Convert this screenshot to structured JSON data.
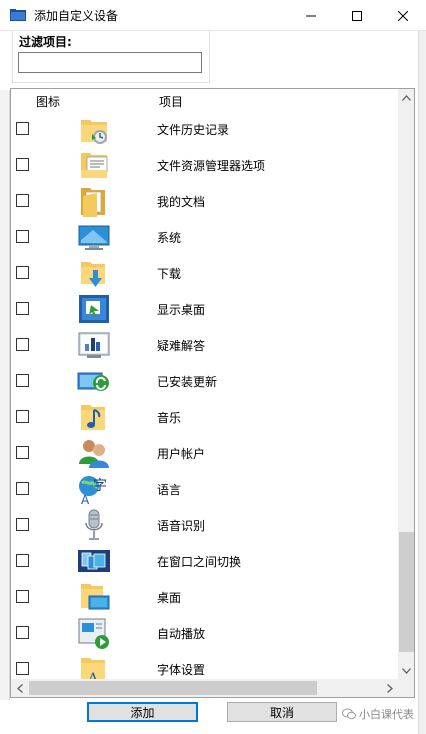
{
  "window": {
    "title": "添加自定义设备",
    "icon": "folder-window-icon",
    "controls": [
      "minimize-icon",
      "maximize-icon",
      "close-icon"
    ]
  },
  "filter": {
    "label": "过滤项目:",
    "value": "",
    "placeholder": ""
  },
  "list": {
    "columns": [
      "图标",
      "项目"
    ],
    "items": [
      {
        "label": "文件历史记录",
        "icon": "file-history-icon",
        "checked": false
      },
      {
        "label": "文件资源管理器选项",
        "icon": "explorer-options-icon",
        "checked": false
      },
      {
        "label": "我的文档",
        "icon": "documents-icon",
        "checked": false
      },
      {
        "label": "系统",
        "icon": "system-icon",
        "checked": false
      },
      {
        "label": "下载",
        "icon": "downloads-icon",
        "checked": false
      },
      {
        "label": "显示桌面",
        "icon": "show-desktop-icon",
        "checked": false
      },
      {
        "label": "疑难解答",
        "icon": "troubleshoot-icon",
        "checked": false
      },
      {
        "label": "已安装更新",
        "icon": "installed-updates-icon",
        "checked": false
      },
      {
        "label": "音乐",
        "icon": "music-icon",
        "checked": false
      },
      {
        "label": "用户帐户",
        "icon": "user-accounts-icon",
        "checked": false
      },
      {
        "label": "语言",
        "icon": "language-icon",
        "checked": false
      },
      {
        "label": "语音识别",
        "icon": "speech-recognition-icon",
        "checked": false
      },
      {
        "label": "在窗口之间切换",
        "icon": "switch-windows-icon",
        "checked": false
      },
      {
        "label": "桌面",
        "icon": "desktop-icon",
        "checked": false
      },
      {
        "label": "自动播放",
        "icon": "autoplay-icon",
        "checked": false
      },
      {
        "label": "字体设置",
        "icon": "font-settings-icon",
        "checked": false
      }
    ]
  },
  "buttons": {
    "add": "添加",
    "cancel": "取消"
  },
  "watermark": {
    "text": "小白课代表",
    "icon": "wechat-icon"
  },
  "colors": {
    "accent": "#0078d7",
    "folder": "#f4c95d",
    "folder_dark": "#e0a92e"
  }
}
